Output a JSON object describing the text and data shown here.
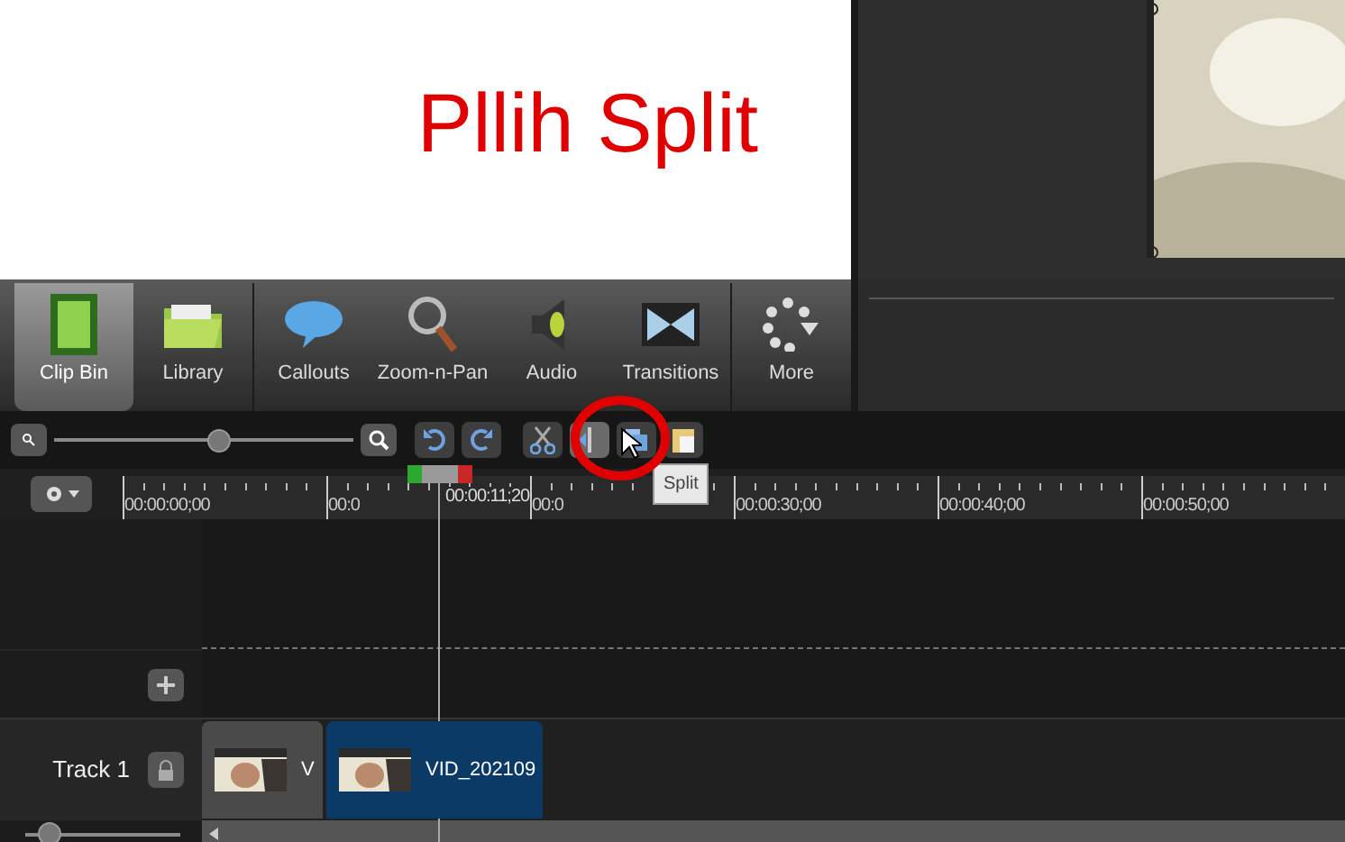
{
  "annotation": "Pllih Split",
  "tab_groups": [
    [
      {
        "label": "Clip Bin",
        "kind": "film",
        "selected": true
      },
      {
        "label": "Library",
        "kind": "folder",
        "selected": false
      }
    ],
    [
      {
        "label": "Callouts",
        "kind": "bubble",
        "selected": false
      },
      {
        "label": "Zoom-n-Pan",
        "kind": "magnifier",
        "selected": false
      },
      {
        "label": "Audio",
        "kind": "speaker",
        "selected": false
      },
      {
        "label": "Transitions",
        "kind": "transition",
        "selected": false
      }
    ],
    [
      {
        "label": "More",
        "kind": "dots",
        "selected": false
      }
    ]
  ],
  "zoom_slider": {
    "level": 0.55
  },
  "toolbar": [
    {
      "kind": "undo",
      "highlighted": false
    },
    {
      "kind": "redo",
      "highlighted": false
    },
    {
      "kind": "cut",
      "highlighted": false
    },
    {
      "kind": "split",
      "highlighted": true
    },
    {
      "kind": "copy",
      "highlighted": false
    },
    {
      "kind": "paste",
      "highlighted": false
    }
  ],
  "tooltip": "Split",
  "ruler_labels": [
    "00:00:00;00",
    "00:0",
    "00:0",
    "00:00:30;00",
    "00:00:40;00",
    "00:00:50;00"
  ],
  "playhead_time": "00:00:11;20",
  "tracks": [
    {
      "name": "Track 1",
      "clips": [
        {
          "label": "V",
          "selected": false
        },
        {
          "label": "VID_202109",
          "selected": true
        }
      ]
    }
  ],
  "track_height_slider": {
    "level": 0.15
  }
}
